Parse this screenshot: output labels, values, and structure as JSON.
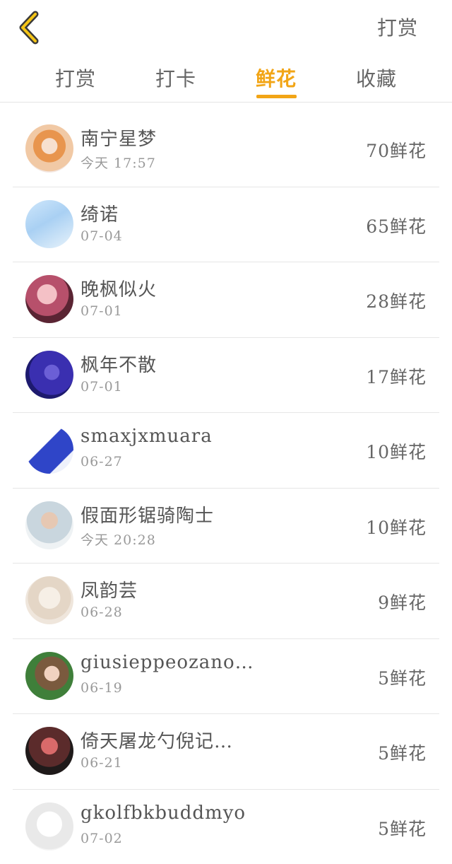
{
  "header": {
    "back_icon": "chevron-left-icon",
    "action_label": "打赏",
    "accent_color": "#f2a516"
  },
  "tabs": [
    {
      "label": "打赏",
      "active": false
    },
    {
      "label": "打卡",
      "active": false
    },
    {
      "label": "鲜花",
      "active": true
    },
    {
      "label": "收藏",
      "active": false
    }
  ],
  "list": [
    {
      "name": "南宁星梦",
      "time": "今天 17:57",
      "amount": "70鲜花"
    },
    {
      "name": "绮诺",
      "time": "07-04",
      "amount": "65鲜花"
    },
    {
      "name": "晚枫似火",
      "time": "07-01",
      "amount": "28鲜花"
    },
    {
      "name": "枫年不散",
      "time": "07-01",
      "amount": "17鲜花"
    },
    {
      "name": "smaxjxmuara",
      "time": "06-27",
      "amount": "10鲜花"
    },
    {
      "name": "假面形锯骑陶士",
      "time": "今天 20:28",
      "amount": "10鲜花"
    },
    {
      "name": "凤韵芸",
      "time": "06-28",
      "amount": "9鲜花"
    },
    {
      "name": "giusieppeozano…",
      "time": "06-19",
      "amount": "5鲜花"
    },
    {
      "name": "倚天屠龙勺倪记…",
      "time": "06-21",
      "amount": "5鲜花"
    },
    {
      "name": "gkolfbkbuddmyo",
      "time": "07-02",
      "amount": "5鲜花"
    }
  ]
}
